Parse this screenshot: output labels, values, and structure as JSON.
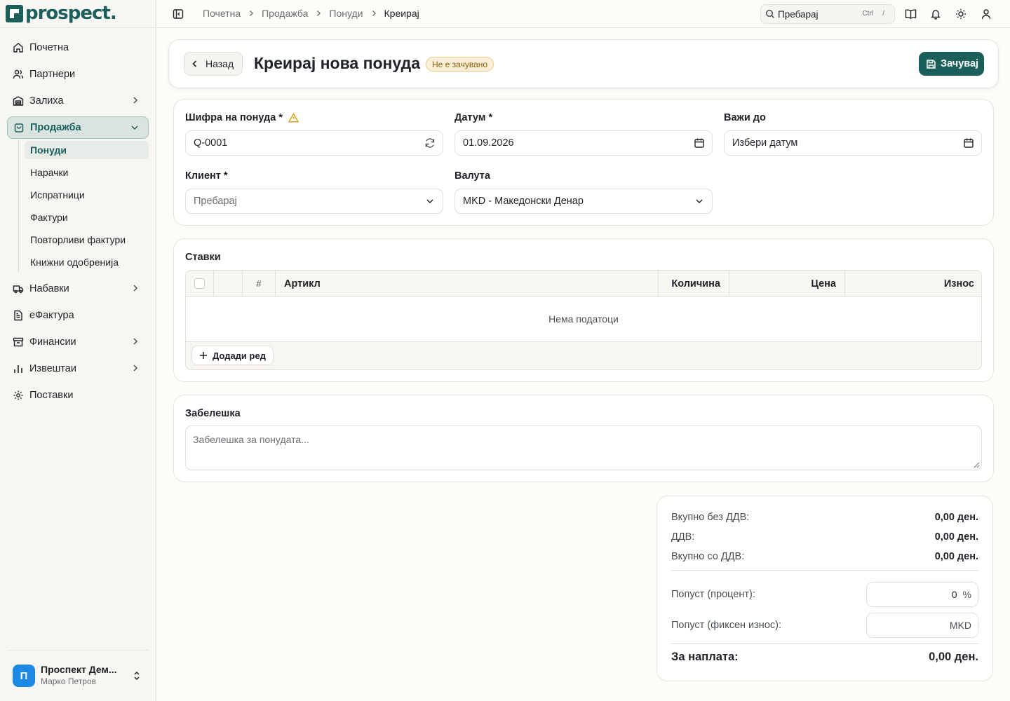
{
  "app": {
    "logo_text": "prospect."
  },
  "sidebar": {
    "items": [
      {
        "label": "Почетна",
        "icon": "home-icon"
      },
      {
        "label": "Партнери",
        "icon": "users-icon"
      },
      {
        "label": "Залиха",
        "icon": "warehouse-icon"
      },
      {
        "label": "Продажба",
        "icon": "shopping-bag-icon"
      },
      {
        "label": "Набавки",
        "icon": "truck-icon"
      },
      {
        "label": "еФактура",
        "icon": "file-icon"
      },
      {
        "label": "Финансии",
        "icon": "archive-icon"
      },
      {
        "label": "Извештаи",
        "icon": "bar-chart-icon"
      },
      {
        "label": "Поставки",
        "icon": "gear-icon"
      }
    ],
    "sales_sub": [
      "Понуди",
      "Нарачки",
      "Испратници",
      "Фактури",
      "Повторливи фактури",
      "Книжни одобренија"
    ],
    "user": {
      "initial": "П",
      "name": "Проспект Дем...",
      "role": "Марко Петров"
    }
  },
  "topbar": {
    "breadcrumb": [
      "Почетна",
      "Продажба",
      "Понуди",
      "Креирај"
    ],
    "search": {
      "placeholder": "Пребарај",
      "shortcut_a": "Ctrl",
      "shortcut_b": "/"
    }
  },
  "header": {
    "back_label": "Назад",
    "title": "Креирај нова понуда",
    "status_badge": "Не е зачувано",
    "save_label": "Зачувај"
  },
  "form": {
    "code_label": "Шифра на понуда *",
    "code_value": "Q-0001",
    "date_label": "Датум *",
    "date_value": "01.09.2026",
    "valid_label": "Важи до",
    "valid_placeholder": "Избери датум",
    "client_label": "Клиент *",
    "client_placeholder": "Пребарај",
    "currency_label": "Валута",
    "currency_value": "MKD - Македонски Денар"
  },
  "items": {
    "title": "Ставки",
    "columns": [
      "#",
      "Артикл",
      "Количина",
      "Цена",
      "Износ"
    ],
    "empty_text": "Нема податоци",
    "add_row_label": "Додади ред"
  },
  "note": {
    "title": "Забелешка",
    "placeholder": "Забелешка за понудата..."
  },
  "totals": {
    "subtotal_label": "Вкупно без ДДВ:",
    "subtotal_value": "0,00 ден.",
    "vat_label": "ДДВ:",
    "vat_value": "0,00 ден.",
    "total_label": "Вкупно со ДДВ:",
    "total_value": "0,00 ден.",
    "discount_pct_label": "Попуст (процент):",
    "discount_pct_value": "0",
    "discount_pct_unit": "%",
    "discount_fixed_label": "Попуст (фиксен износ):",
    "discount_fixed_unit": "MKD",
    "due_label": "За наплата:",
    "due_value": "0,00 ден."
  },
  "colors": {
    "brand": "#1b5f5b",
    "badge_bg": "#fbf0d7",
    "badge_text": "#8a5a10",
    "avatar": "#1e88e5"
  }
}
